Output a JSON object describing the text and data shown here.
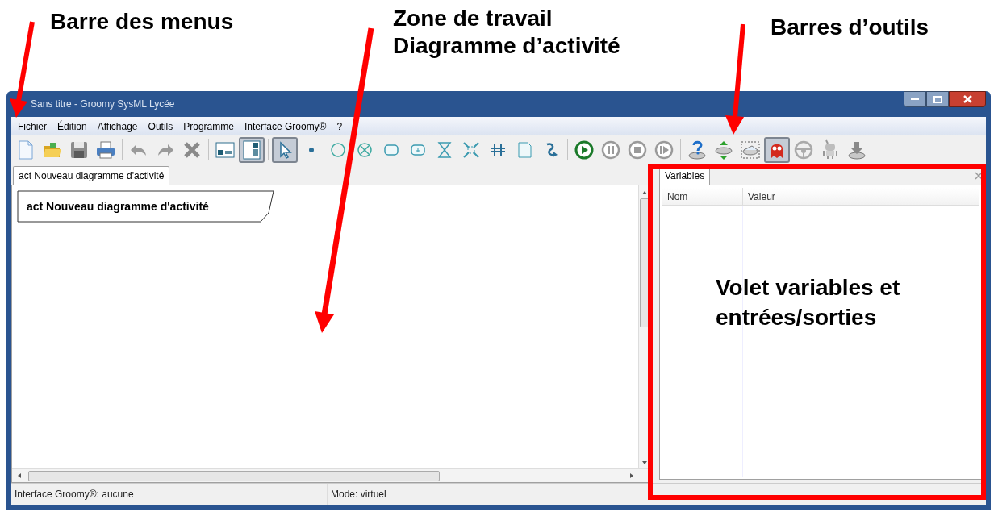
{
  "annotations": [
    {
      "text": "Barre des menus"
    },
    {
      "text": "Zone de travail\nDiagramme d’activité"
    },
    {
      "text": "Barres d’outils"
    },
    {
      "text": "Volet variables et\nentrées/sorties"
    }
  ],
  "window": {
    "title": "Sans titre - Groomy SysML Lycée"
  },
  "menu": [
    "Fichier",
    "Édition",
    "Affichage",
    "Outils",
    "Programme",
    "Interface Groomy®",
    "?"
  ],
  "toolbar_groups": [
    [
      {
        "kind": "new",
        "pressed": false
      },
      {
        "kind": "open",
        "pressed": false
      },
      {
        "kind": "save",
        "pressed": false
      },
      {
        "kind": "print",
        "pressed": false
      }
    ],
    [
      {
        "kind": "undo",
        "pressed": false
      },
      {
        "kind": "redo",
        "pressed": false
      },
      {
        "kind": "delete",
        "pressed": false
      }
    ],
    [
      {
        "kind": "layout-a",
        "pressed": false
      },
      {
        "kind": "layout-b",
        "pressed": true
      }
    ],
    [
      {
        "kind": "pointer",
        "pressed": true
      },
      {
        "kind": "dot",
        "pressed": false
      },
      {
        "kind": "circle",
        "pressed": false
      },
      {
        "kind": "circle-x",
        "pressed": false
      },
      {
        "kind": "action",
        "pressed": false
      },
      {
        "kind": "sub-action",
        "pressed": false
      },
      {
        "kind": "hourglass",
        "pressed": false
      },
      {
        "kind": "expand",
        "pressed": false
      },
      {
        "kind": "fork",
        "pressed": false
      },
      {
        "kind": "note",
        "pressed": false
      },
      {
        "kind": "flow",
        "pressed": false
      }
    ],
    [
      {
        "kind": "play",
        "pressed": false
      },
      {
        "kind": "pause",
        "pressed": false
      },
      {
        "kind": "stop",
        "pressed": false
      },
      {
        "kind": "step",
        "pressed": false
      }
    ],
    [
      {
        "kind": "help-disk",
        "pressed": false
      },
      {
        "kind": "sync-disk",
        "pressed": false
      },
      {
        "kind": "dashed-disk",
        "pressed": false
      },
      {
        "kind": "ghost",
        "pressed": true
      },
      {
        "kind": "wheel",
        "pressed": false
      },
      {
        "kind": "robot",
        "pressed": false
      },
      {
        "kind": "download-disk",
        "pressed": false
      }
    ]
  ],
  "document_tab": {
    "label": "act Nouveau diagramme d'activité",
    "selected": true
  },
  "diagram": {
    "frame_label": "act Nouveau diagramme d'activité"
  },
  "variables_panel": {
    "tab": {
      "label": "Variables",
      "selected": true
    },
    "columns": [
      "Nom",
      "Valeur"
    ]
  },
  "status_bar": [
    "Interface Groomy®: aucune",
    "Mode: virtuel"
  ]
}
